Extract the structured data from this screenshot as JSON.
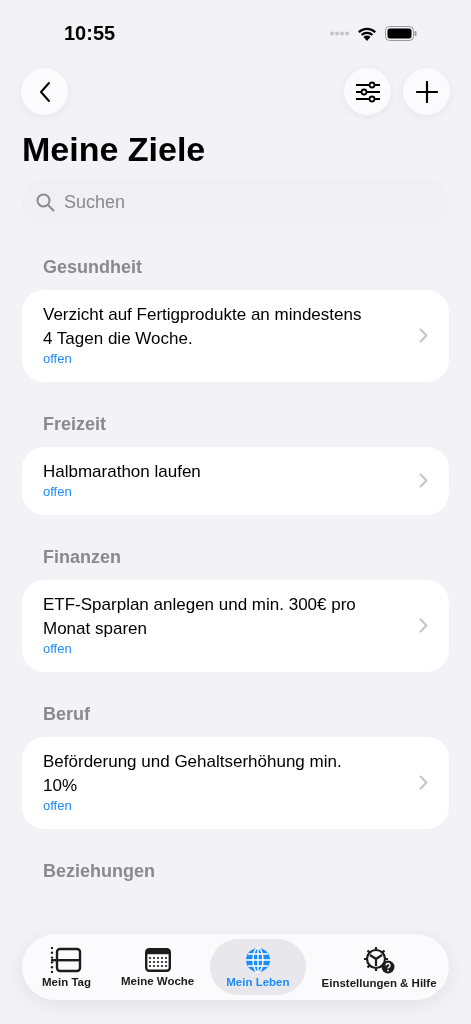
{
  "status_bar": {
    "time": "10:55"
  },
  "title": "Meine Ziele",
  "search": {
    "placeholder": "Suchen"
  },
  "sections": [
    {
      "title": "Gesundheit",
      "goals": [
        {
          "text": "Verzicht auf Fertigprodukte an mindestens 4 Tagen die Woche.",
          "status": "offen"
        }
      ]
    },
    {
      "title": "Freizeit",
      "goals": [
        {
          "text": "Halbmarathon laufen",
          "status": "offen"
        }
      ]
    },
    {
      "title": "Finanzen",
      "goals": [
        {
          "text": "ETF-Sparplan anlegen und min. 300€ pro Monat sparen",
          "status": "offen"
        }
      ]
    },
    {
      "title": "Beruf",
      "goals": [
        {
          "text": "Beförderung und Gehaltserhöhung min. 10%",
          "status": "offen"
        }
      ]
    },
    {
      "title": "Beziehungen"
    }
  ],
  "tabs": [
    {
      "label": "Mein Tag",
      "kind": "day",
      "selected": false
    },
    {
      "label": "Meine Woche",
      "kind": "week",
      "selected": false
    },
    {
      "label": "Mein Leben",
      "kind": "life",
      "selected": true
    },
    {
      "label": "Einstellungen & Hilfe",
      "kind": "settings",
      "selected": false
    }
  ]
}
